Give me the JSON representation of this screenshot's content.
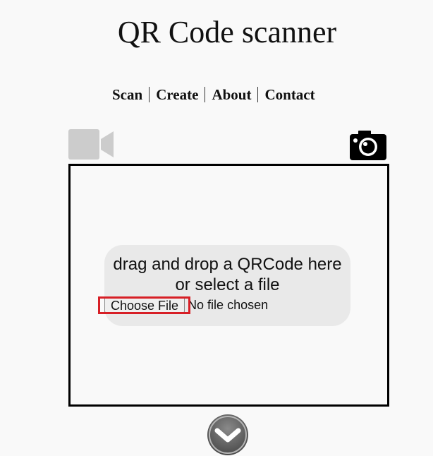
{
  "header": {
    "title": "QR Code scanner"
  },
  "nav": {
    "items": [
      {
        "label": "Scan"
      },
      {
        "label": "Create"
      },
      {
        "label": "About"
      },
      {
        "label": "Contact"
      }
    ]
  },
  "icons": {
    "video": "video-camera-icon",
    "camera": "photo-camera-icon",
    "scroll_down": "chevron-down-icon"
  },
  "scanner": {
    "drop_text_line1": "drag and drop a QRCode here",
    "drop_text_line2": "or select a file",
    "choose_file_label": "Choose File",
    "file_status": "No file chosen"
  },
  "colors": {
    "highlight": "#d71f26",
    "video_icon": "#cccccc",
    "camera_icon": "#000000",
    "drop_zone_bg": "#e9e9e9"
  }
}
